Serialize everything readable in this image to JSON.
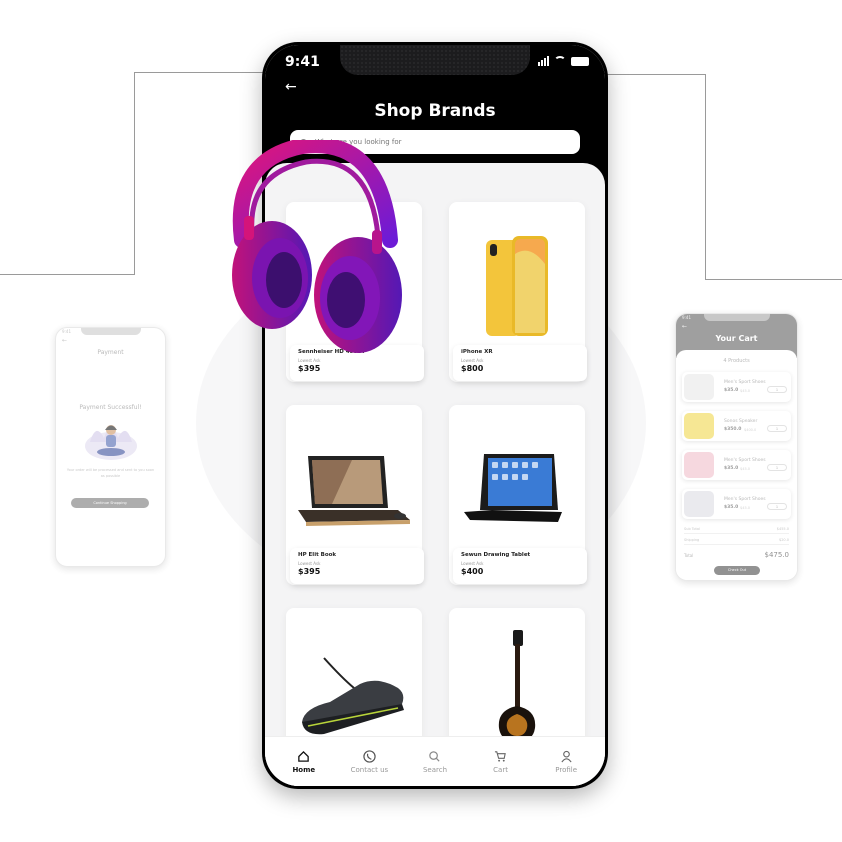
{
  "main": {
    "status_time": "9:41",
    "title": "Shop Brands",
    "search_placeholder": "What are you looking for",
    "products": [
      {
        "name": "Sennheiser HD 450BT",
        "label": "Lowest Ask",
        "price": "$395",
        "icon": "headphones"
      },
      {
        "name": "iPhone XR",
        "label": "Lowest Ask",
        "price": "$800",
        "icon": "phone"
      },
      {
        "name": "HP Elit Book",
        "label": "Lowest Ask",
        "price": "$395",
        "icon": "laptop"
      },
      {
        "name": "Sewun Drawing Tablet",
        "label": "Lowest Ask",
        "price": "$400",
        "icon": "tablet"
      },
      {
        "name": "",
        "label": "",
        "price": "",
        "icon": "sneaker"
      },
      {
        "name": "",
        "label": "",
        "price": "",
        "icon": "guitar"
      }
    ],
    "tabs": [
      {
        "label": "Home",
        "icon": "home-icon",
        "active": true
      },
      {
        "label": "Contact us",
        "icon": "phone-call-icon",
        "active": false
      },
      {
        "label": "Search",
        "icon": "search-icon",
        "active": false
      },
      {
        "label": "Cart",
        "icon": "cart-icon",
        "active": false
      },
      {
        "label": "Profile",
        "icon": "profile-icon",
        "active": false
      }
    ]
  },
  "payment_screen": {
    "status_time": "9:41",
    "title": "Payment",
    "success": "Payment Successful!",
    "desc": "Your order will be processed and sent to you soon as possible",
    "button": "Continue Shopping"
  },
  "cart_screen": {
    "status_time": "9:41",
    "title": "Your Cart",
    "count": "4 Products",
    "items": [
      {
        "name": "Men's Sport Shoes",
        "price": "$35.0",
        "old": "$45.0",
        "qty": "1",
        "thumb": "#eeeeee"
      },
      {
        "name": "Sonos Speaker",
        "price": "$350.0",
        "old": "$400.0",
        "qty": "1",
        "thumb": "#f4e27a"
      },
      {
        "name": "Men's Sport Shoes",
        "price": "$35.0",
        "old": "$45.0",
        "qty": "1",
        "thumb": "#f5cfd8"
      },
      {
        "name": "Men's Sport Shoes",
        "price": "$35.0",
        "old": "$45.0",
        "qty": "1",
        "thumb": "#e6e6ea"
      }
    ],
    "subtotal_label": "Sub Total",
    "subtotal": "$455.0",
    "shipping_label": "Shipping",
    "shipping": "$20.0",
    "total_label": "Total",
    "total": "$475.0",
    "button": "Check Out"
  }
}
